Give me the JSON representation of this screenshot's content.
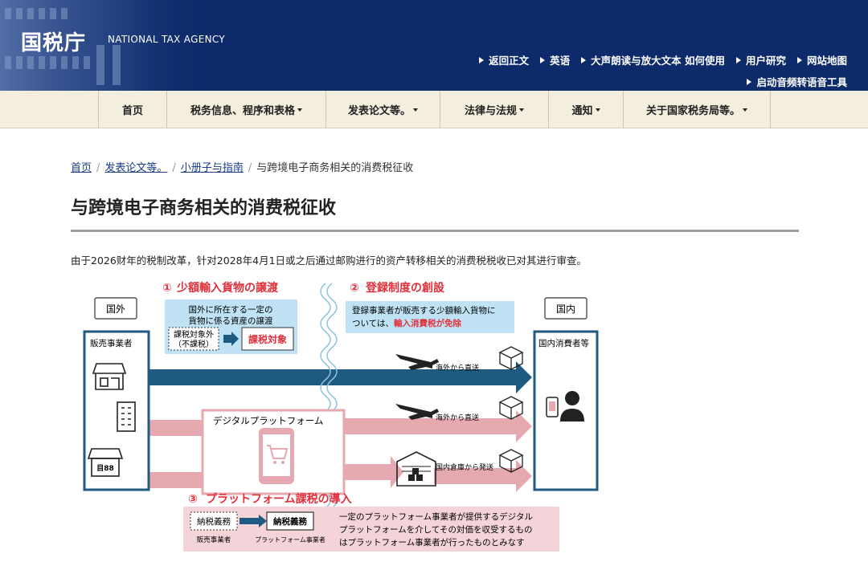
{
  "header": {
    "logo": "国税庁",
    "logo_en": "NATIONAL TAX AGENCY",
    "util_links": [
      "返回正文",
      "英语",
      "大声朗读与放大文本 如何使用",
      "用户研究",
      "网站地图"
    ],
    "util_links_row2": [
      "启动音频转语音工具"
    ]
  },
  "nav": {
    "items": [
      {
        "label": "首页"
      },
      {
        "label": "税务信息、程序和表格"
      },
      {
        "label": "发表论文等。"
      },
      {
        "label": "法律与法规"
      },
      {
        "label": "通知"
      },
      {
        "label": "关于国家税务局等。"
      }
    ]
  },
  "breadcrumb": {
    "items": [
      "首页",
      "发表论文等。",
      "小册子与指南"
    ],
    "current": "与跨境电子商务相关的消费税征收"
  },
  "page": {
    "title": "与跨境电子商务相关的消费税征收",
    "lead": "由于2026财年的税制改革，针对2028年4月1日或之后通过邮购进行的资产转移相关的消费税税收已对其进行审查。"
  },
  "diagram": {
    "overseas_label": "国外",
    "domestic_label": "国内",
    "seller_label": "販売事業者",
    "consumer_label": "国内消費者等",
    "point1": {
      "number": "①",
      "title": "少額輸入貨物の譲渡",
      "desc_line1": "国外に所在する一定の",
      "desc_line2": "貨物に係る資産の譲渡",
      "before_line1": "課税対象外",
      "before_line2": "（不課税）",
      "after": "課税対象"
    },
    "point2": {
      "number": "②",
      "title": "登録制度の創設",
      "desc_line1": "登録事業者が販売する少額輸入貨物に",
      "desc_line2_prefix": "ついては、",
      "desc_line2_highlight": "輸入消費税が免除"
    },
    "point3": {
      "number": "③",
      "title": "プラットフォーム課税の導入",
      "duty_label": "納税義務",
      "from_label": "販売事業者",
      "to_label": "プラットフォーム事業者",
      "desc_line1": "一定のプラットフォーム事業者が提供するデジタル",
      "desc_line2": "プラットフォームを介してその対価を収受するもの",
      "desc_line3": "はプラットフォーム事業者が行ったものとみなす"
    },
    "platform_label": "デジタルプラットフォーム",
    "route1": "海外から直送",
    "route2": "海外から直送",
    "route3": "国内倉庫から発送",
    "store_sign": "目88",
    "colors": {
      "navy": "#0d2a6b",
      "teal": "#1f5a80",
      "pink": "#e0a0a8",
      "red": "#e0303b",
      "light_blue": "#bfe3f5"
    }
  }
}
